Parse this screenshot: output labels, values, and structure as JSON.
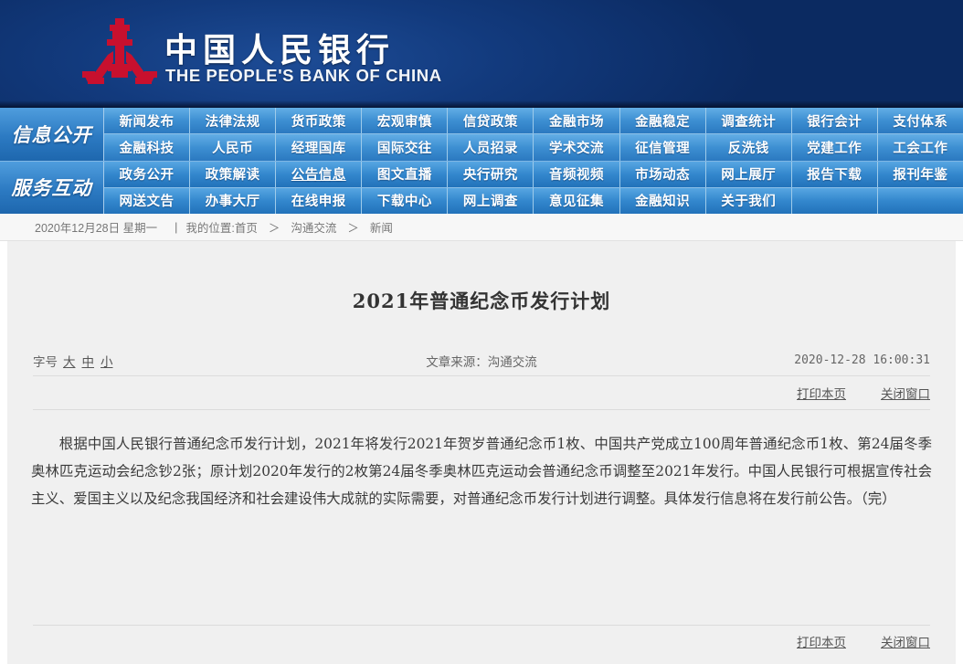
{
  "header": {
    "bank_name_cn": "中国人民银行",
    "bank_name_en": "THE PEOPLE'S BANK OF CHINA",
    "logo_icon": "pbc-logo-icon",
    "brand_color": "#c8102e",
    "banner_color": "#0c2f6b"
  },
  "nav": {
    "accent_color": "#2f7dc4",
    "groups": [
      {
        "label": "信息公开",
        "rows": [
          [
            "新闻发布",
            "法律法规",
            "货币政策",
            "宏观审慎",
            "信贷政策",
            "金融市场",
            "金融稳定",
            "调查统计",
            "银行会计",
            "支付体系"
          ],
          [
            "金融科技",
            "人民币",
            "经理国库",
            "国际交往",
            "人员招录",
            "学术交流",
            "征信管理",
            "反洗钱",
            "党建工作",
            "工会工作"
          ]
        ]
      },
      {
        "label": "服务互动",
        "rows": [
          [
            "政务公开",
            "政策解读",
            "公告信息",
            "图文直播",
            "央行研究",
            "音频视频",
            "市场动态",
            "网上展厅",
            "报告下载",
            "报刊年鉴"
          ],
          [
            "网送文告",
            "办事大厅",
            "在线申报",
            "下载中心",
            "网上调查",
            "意见征集",
            "金融知识",
            "关于我们",
            "",
            ""
          ]
        ]
      }
    ],
    "active_item": "公告信息"
  },
  "breadcrumb": {
    "date": "2020年12月28日 星期一",
    "separator": "|",
    "location_label": "我的位置:",
    "arrow": "＞",
    "items": [
      "首页",
      "沟通交流",
      "新闻"
    ]
  },
  "article": {
    "title": "2021年普通纪念币发行计划",
    "font_size_label": "字号",
    "font_size_options": [
      "大",
      "中",
      "小"
    ],
    "source": "文章来源：沟通交流",
    "timestamp": "2020-12-28 16:00:31",
    "print_label": "打印本页",
    "close_label": "关闭窗口",
    "body": "根据中国人民银行普通纪念币发行计划，2021年将发行2021年贺岁普通纪念币1枚、中国共产党成立100周年普通纪念币1枚、第24届冬季奥林匹克运动会纪念钞2张；原计划2020年发行的2枚第24届冬季奥林匹克运动会普通纪念币调整至2021年发行。中国人民银行可根据宣传社会主义、爱国主义以及纪念我国经济和社会建设伟大成就的实际需要，对普通纪念币发行计划进行调整。具体发行信息将在发行前公告。（完）"
  }
}
